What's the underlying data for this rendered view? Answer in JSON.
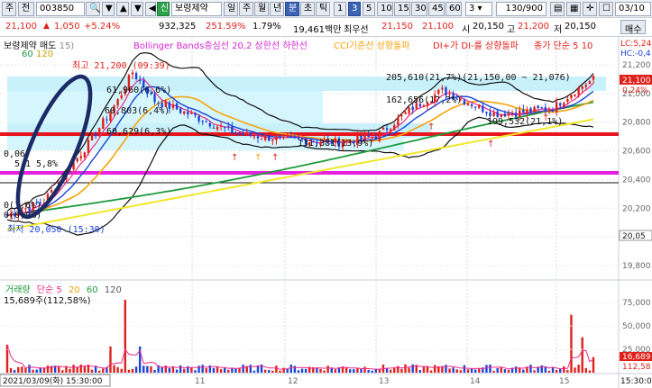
{
  "toolbar": {
    "item_type": "주",
    "item_prev": "전",
    "code": "003850",
    "new_badge": "신",
    "stock_name": "보령제약",
    "periods": [
      "일",
      "주",
      "월",
      "년",
      "분",
      "초",
      "틱"
    ],
    "active_period": "분",
    "intervals": [
      "1",
      "3",
      "5",
      "10",
      "15",
      "30",
      "45",
      "60"
    ],
    "active_interval": "3",
    "interval_select": "3",
    "count": "130/900",
    "date_field": "03/10"
  },
  "price_row": {
    "price": "21,100",
    "arrow": "▲",
    "change": "1,050",
    "change_pct": "+5.24%",
    "volume": "932,325",
    "vol_ratio": "251.59%",
    "turnover": "1.79%",
    "amount": "19,461백만",
    "best_ask_label": "최우선",
    "best_ask": "21,150",
    "best_bid": "21,100",
    "open_label": "시",
    "open": "20,150",
    "high_label": "고",
    "high": "21,200",
    "low_label": "저",
    "low": "20,150",
    "trade_button": "매수"
  },
  "legend": {
    "price_title": "보령제약 매도",
    "ma_suffix": "15)",
    "ma_60": "60",
    "ma_120": "120",
    "bollinger": "Bollinger Bands중심선 20,2  상한선  하한선",
    "cci": "CCI기준선 상향돌파",
    "dmi": "DI+가 DI-를 상향돌파",
    "ma_simple": "종가 단순 5  10",
    "lc": "LC:5,24",
    "hc": "HC:-0,4"
  },
  "annotations": {
    "high_marker": "최고 21,200 (09:39)",
    "low_marker": "최저 20,050 (15:30)",
    "a1": "61,960(6,6%)",
    "a2": "60,803(6,4%)",
    "a3": "60,629(6,3%)",
    "a4": "131,381(13,9%)",
    "a5": "205,610(21,7%)(21,150,00 ~ 21,076)",
    "a6": "162,656(17,2%)",
    "a7": "199,532(21,1%)",
    "left1": "0,06",
    "left2": "5,1",
    "left3": "5,8%",
    "left4": "0(1,6%)",
    "left5": "0(0,0%)"
  },
  "price_axis": {
    "ticks": [
      "21,200",
      "21,000",
      "20,800",
      "20,600",
      "20,400",
      "20,200",
      "20,000",
      "19,800"
    ],
    "current_price_box": "21,100",
    "current_pct_box": "0,24%",
    "marker_20005": "20,05"
  },
  "volume_pane": {
    "title": "거래량",
    "ma_label": "단순 5",
    "ma_20": "20",
    "ma_60": "60",
    "ma_120": "120",
    "current": "15,689주(112,58%)",
    "ticks": [
      "75,000",
      "50,000",
      "25,000"
    ],
    "current_box": "16,689",
    "pct_box": "112,58"
  },
  "time_axis": {
    "cursor_time": "2021/03/09(화) 15:30:00",
    "days": [
      "11",
      "12",
      "13",
      "14",
      "15"
    ],
    "right_time": "15:30:0"
  },
  "colors": {
    "up": "#e0201a",
    "down": "#1a44d6",
    "ma5": "#ef2a8a",
    "ma10": "#1a44d6",
    "ma20": "#f7a20a",
    "ma60": "#1e9b3c",
    "ma120": "#f0e72a",
    "bollinger": "#111111",
    "hline_red": "#e8141e",
    "hline_magenta": "#e820e0",
    "highlight": "#1c2a66"
  }
}
